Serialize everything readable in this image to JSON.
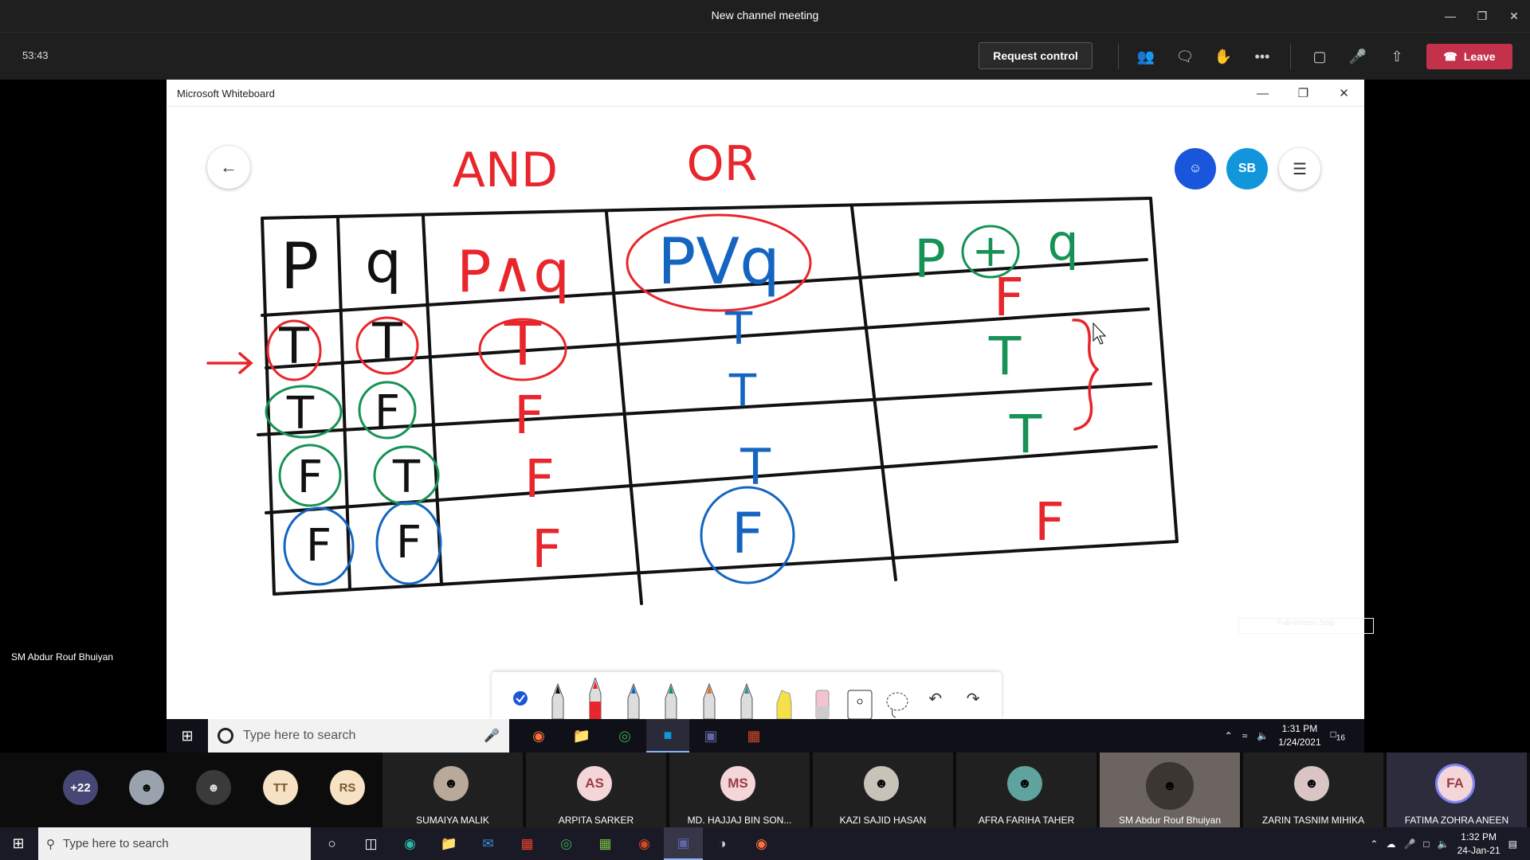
{
  "teams": {
    "window_title": "New channel meeting",
    "timer": "53:43",
    "request_control_label": "Request control",
    "leave_label": "Leave"
  },
  "whiteboard": {
    "window_title": "Microsoft Whiteboard",
    "avatar_sb": "SB",
    "snip_label": "Full-screen Snip",
    "labels": {
      "and": "AND",
      "or": "OR",
      "col_p": "P",
      "col_q": "q",
      "col_and": "P∧q",
      "col_or": "PVq",
      "col_xor_p": "P",
      "col_xor_op": "+",
      "col_xor_q": "q"
    },
    "truth_table": {
      "p": [
        "T",
        "T",
        "F",
        "F"
      ],
      "q": [
        "T",
        "F",
        "T",
        "F"
      ],
      "and": [
        "T",
        "F",
        "F",
        "F"
      ],
      "or": [
        "T",
        "T",
        "T",
        "F"
      ],
      "xor": [
        "F",
        "T",
        "T",
        "F"
      ]
    },
    "colors": {
      "ink_black": "#111111",
      "ink_red": "#e8262c",
      "ink_green": "#169255",
      "ink_blue": "#1565c0",
      "accent_blue": "#1a56db",
      "accent_cyan": "#1296db"
    }
  },
  "presenter_taskbar": {
    "presenter_name": "SM Abdur Rouf Bhuiyan",
    "search_placeholder": "Type here to search",
    "time": "1:31 PM",
    "date": "1/24/2021",
    "notif_count": "16"
  },
  "participants": {
    "overflow": "+22",
    "initials": [
      "TT",
      "RS"
    ],
    "tiles": [
      {
        "name": "SUMAIYA MALIK",
        "initials": ""
      },
      {
        "name": "ARPITA SARKER",
        "initials": "AS"
      },
      {
        "name": "MD. HAJJAJ BIN SON...",
        "initials": "MS"
      },
      {
        "name": "KAZI SAJID HASAN",
        "initials": ""
      },
      {
        "name": "AFRA FARIHA TAHER",
        "initials": ""
      },
      {
        "name": "SM Abdur Rouf Bhuiyan",
        "initials": ""
      },
      {
        "name": "ZARIN TASNIM MIHIKA",
        "initials": ""
      },
      {
        "name": "FATIMA ZOHRA ANEEN",
        "initials": "FA"
      }
    ]
  },
  "taskbar": {
    "search_placeholder": "Type here to search",
    "time": "1:32 PM",
    "date": "24-Jan-21"
  }
}
